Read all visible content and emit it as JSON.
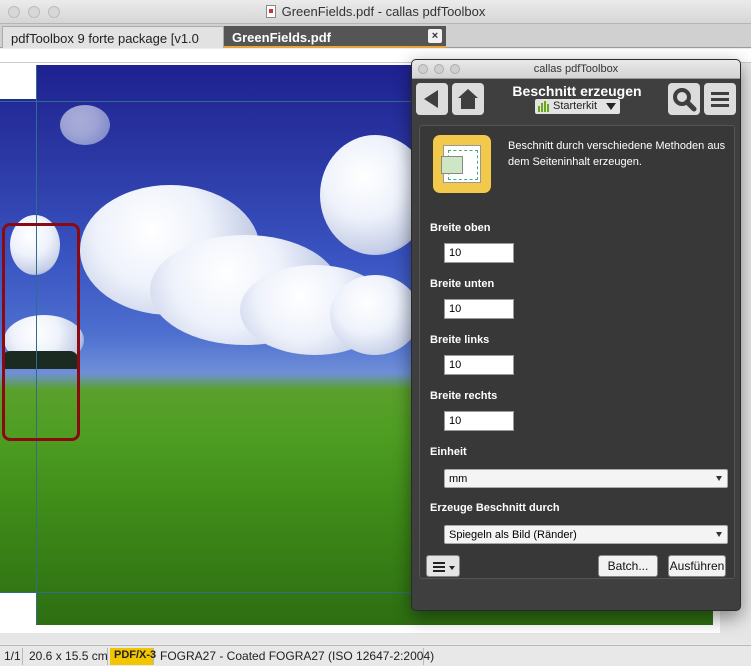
{
  "window": {
    "title": "GreenFields.pdf - callas pdfToolbox"
  },
  "tabs": [
    {
      "label": "pdfToolbox 9 forte package [v1.0"
    },
    {
      "label": "GreenFields.pdf"
    }
  ],
  "tab_close_glyph": "×",
  "statusbar": {
    "page": "1/1",
    "size": "20.6 x 15.5 cm",
    "standard": "PDF/X-3",
    "profile": "FOGRA27 - Coated FOGRA27 (ISO 12647-2:2004)"
  },
  "panel": {
    "window_title": "callas pdfToolbox",
    "title": "Beschnitt erzeugen",
    "kit": "Starterkit",
    "description": "Beschnitt durch verschiedene Methoden aus dem Seiteninhalt erzeugen.",
    "fields": {
      "top_label": "Breite oben",
      "top_value": "10",
      "bottom_label": "Breite unten",
      "bottom_value": "10",
      "left_label": "Breite links",
      "left_value": "10",
      "right_label": "Breite rechts",
      "right_value": "10",
      "unit_label": "Einheit",
      "unit_value": "mm",
      "method_label": "Erzeuge Beschnitt durch",
      "method_value": "Spiegeln als Bild (Ränder)"
    },
    "buttons": {
      "batch": "Batch...",
      "run": "Ausführen"
    }
  },
  "icons": [
    "document-icon",
    "back-arrow-icon",
    "home-icon",
    "search-icon",
    "menu-icon",
    "starterkit-icon",
    "chevron-down-icon",
    "fixup-bleed-icon",
    "list-menu-icon",
    "close-icon"
  ],
  "colors": {
    "highlight": "#8b0a12",
    "badge": "#f2c500",
    "active_tab_accent": "#e8a63a",
    "panel_bg": "#3f3f3f",
    "guide": "#2f6d8d"
  }
}
